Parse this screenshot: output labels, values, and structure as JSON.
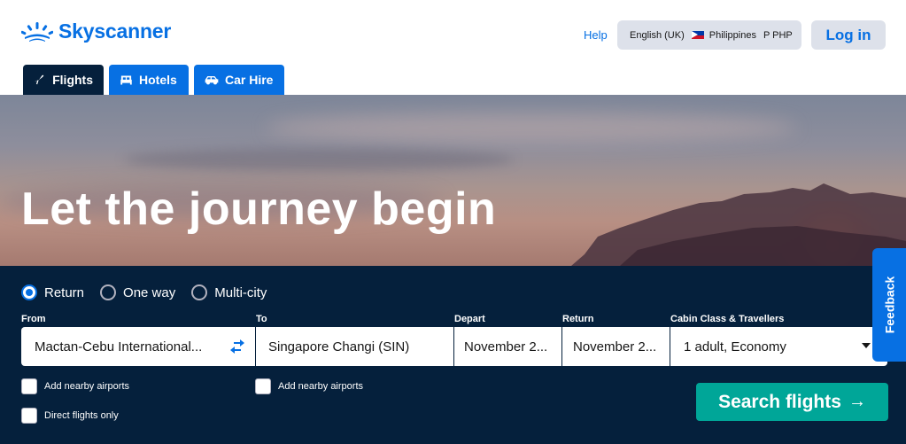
{
  "header": {
    "brand": "Skyscanner",
    "help": "Help",
    "locale": {
      "language": "English (UK)",
      "country": "Philippines",
      "currency": "P PHP"
    },
    "login": "Log in"
  },
  "tabs": [
    {
      "label": "Flights",
      "icon": "plane-icon",
      "active": true
    },
    {
      "label": "Hotels",
      "icon": "bed-icon",
      "active": false
    },
    {
      "label": "Car Hire",
      "icon": "car-icon",
      "active": false
    }
  ],
  "hero": {
    "headline": "Let the journey begin"
  },
  "search": {
    "trip_types": [
      {
        "label": "Return",
        "selected": true
      },
      {
        "label": "One way",
        "selected": false
      },
      {
        "label": "Multi-city",
        "selected": false
      }
    ],
    "labels": {
      "from": "From",
      "to": "To",
      "depart": "Depart",
      "return": "Return",
      "cabin": "Cabin Class & Travellers"
    },
    "values": {
      "from": "Mactan-Cebu International...",
      "to": "Singapore Changi (SIN)",
      "depart": "November 2...",
      "return": "November 2...",
      "cabin": "1 adult, Economy"
    },
    "checkboxes": {
      "nearby_from": "Add nearby airports",
      "nearby_to": "Add nearby airports",
      "direct": "Direct flights only"
    },
    "submit": "Search flights",
    "submit_arrow": "→"
  },
  "feedback": "Feedback",
  "colors": {
    "brand_blue": "#0770e3",
    "navy": "#05203c",
    "teal": "#00a698",
    "grey": "#dde1ea"
  }
}
